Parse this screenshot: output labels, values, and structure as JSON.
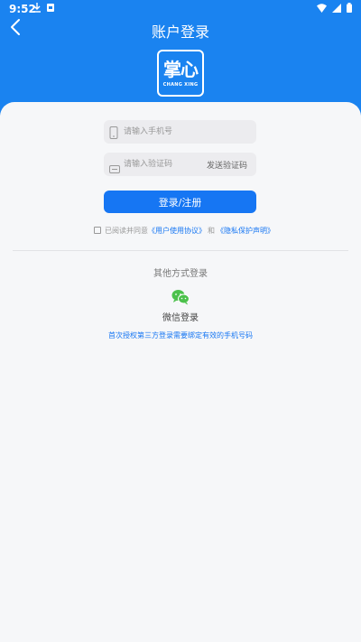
{
  "status_bar": {
    "time": "9:52"
  },
  "header": {
    "title": "账户登录"
  },
  "logo": {
    "main_text": "掌心",
    "sub_text": "CHANG XING"
  },
  "form": {
    "phone_placeholder": "请输入手机号",
    "code_placeholder": "请输入验证码",
    "send_code_label": "发送验证码",
    "login_button_label": "登录/注册"
  },
  "agreement": {
    "prefix": "已阅读并同意",
    "user_agreement": "《用户使用协议》",
    "conjunction": "和",
    "privacy_policy": "《隐私保护声明》"
  },
  "other_login": {
    "title": "其他方式登录",
    "wechat_label": "微信登录",
    "note": "首次授权第三方登录需要绑定有效的手机号码"
  },
  "colors": {
    "brand_blue": "#1a83f0",
    "button_blue": "#1676f3",
    "wechat_green": "#4cc14c"
  }
}
